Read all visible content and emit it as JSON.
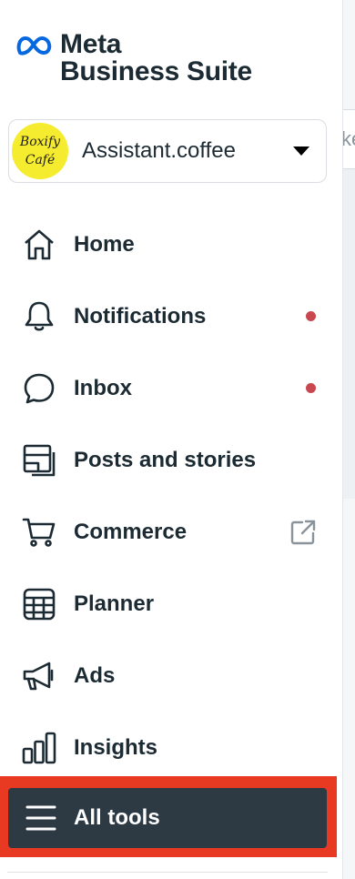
{
  "brand": {
    "line1": "Meta",
    "line2": "Business Suite"
  },
  "account": {
    "avatar_line1": "Boxify",
    "avatar_line2": "Café",
    "name": "Assistant.coffee"
  },
  "right_edge": {
    "partial_text": "ke"
  },
  "nav": {
    "items": [
      {
        "label": "Home",
        "icon": "home-icon"
      },
      {
        "label": "Notifications",
        "icon": "bell-icon",
        "badge": true
      },
      {
        "label": "Inbox",
        "icon": "chat-bubble-icon",
        "badge": true
      },
      {
        "label": "Posts and stories",
        "icon": "posts-icon"
      },
      {
        "label": "Commerce",
        "icon": "cart-icon",
        "external": true
      },
      {
        "label": "Planner",
        "icon": "calendar-grid-icon"
      },
      {
        "label": "Ads",
        "icon": "megaphone-icon"
      },
      {
        "label": "Insights",
        "icon": "bar-chart-icon"
      }
    ]
  },
  "all_tools": {
    "label": "All tools",
    "icon": "hamburger-menu-icon"
  },
  "colors": {
    "text": "#1c2b33",
    "badge": "#c9474f",
    "highlight": "#e83a22",
    "all_tools_bg": "#2d3a44",
    "avatar_bg": "#f6ec2f"
  }
}
